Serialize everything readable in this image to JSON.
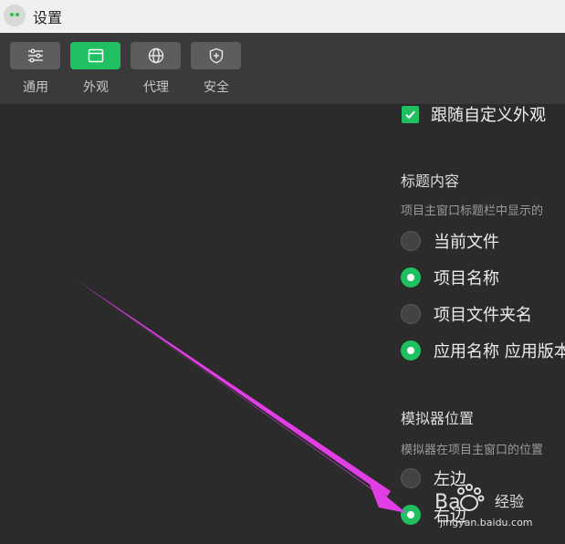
{
  "window": {
    "title": "设置"
  },
  "tabs": [
    {
      "label": "通用",
      "icon": "sliders-icon",
      "active": false
    },
    {
      "label": "外观",
      "icon": "window-icon",
      "active": true
    },
    {
      "label": "代理",
      "icon": "globe-icon",
      "active": false
    },
    {
      "label": "安全",
      "icon": "shield-icon",
      "active": false
    }
  ],
  "follow_custom": {
    "label": "跟随自定义外观",
    "checked": true
  },
  "title_content": {
    "heading": "标题内容",
    "description": "项目主窗口标题栏中显示的",
    "options": [
      {
        "label": "当前文件",
        "checked": false
      },
      {
        "label": "项目名称",
        "checked": true
      },
      {
        "label": "项目文件夹名",
        "checked": false
      },
      {
        "label": "应用名称 应用版本",
        "checked": true
      }
    ]
  },
  "simulator_position": {
    "heading": "模拟器位置",
    "description": "模拟器在项目主窗口的位置",
    "options": [
      {
        "label": "左边",
        "checked": false
      },
      {
        "label": "右边",
        "checked": true
      }
    ]
  },
  "watermark": {
    "brand": "经验",
    "url": "jingyan.baidu.com"
  },
  "colors": {
    "accent": "#1fbf62",
    "annotation_arrow": "#e23ee6"
  }
}
